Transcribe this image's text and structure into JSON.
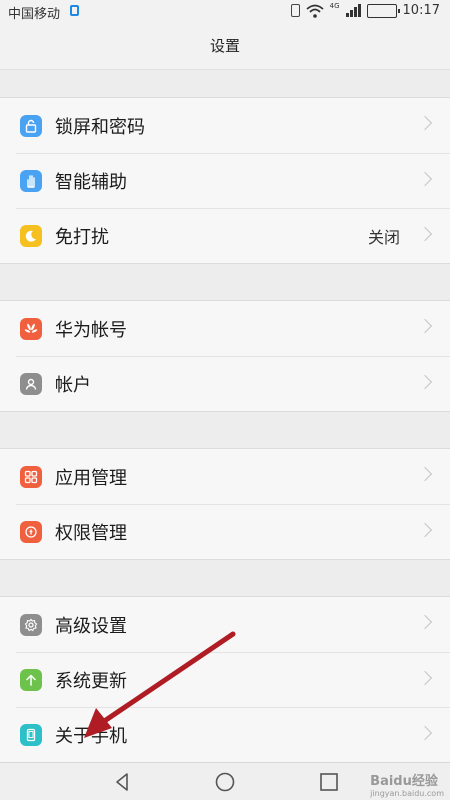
{
  "status_bar": {
    "carrier": "中国移动",
    "network": "4G",
    "time": "10:17"
  },
  "header": {
    "title": "设置"
  },
  "groups": [
    {
      "items": [
        {
          "label": "锁屏和密码",
          "icon": "lock-icon",
          "icon_color": "#4aa3f2"
        },
        {
          "label": "智能辅助",
          "icon": "hand-icon",
          "icon_color": "#4aa3f2"
        },
        {
          "label": "免打扰",
          "icon": "moon-icon",
          "icon_color": "#f5c020",
          "value": "关闭"
        }
      ]
    },
    {
      "items": [
        {
          "label": "华为帐号",
          "icon": "huawei-icon",
          "icon_color": "#f0603e"
        },
        {
          "label": "帐户",
          "icon": "user-icon",
          "icon_color": "#8e8e8e"
        }
      ]
    },
    {
      "items": [
        {
          "label": "应用管理",
          "icon": "grid-icon",
          "icon_color": "#f0603e"
        },
        {
          "label": "权限管理",
          "icon": "shield-icon",
          "icon_color": "#f0603e"
        }
      ]
    },
    {
      "items": [
        {
          "label": "高级设置",
          "icon": "gear-icon",
          "icon_color": "#8e8e8e"
        },
        {
          "label": "系统更新",
          "icon": "arrow-up-icon",
          "icon_color": "#6cc24a"
        },
        {
          "label": "关于手机",
          "icon": "phone-icon",
          "icon_color": "#2ec0c9"
        }
      ]
    }
  ],
  "watermark": {
    "text": "Baidu经验",
    "url": "jingyan.baidu.com"
  },
  "annotation_color": "#b01c24"
}
